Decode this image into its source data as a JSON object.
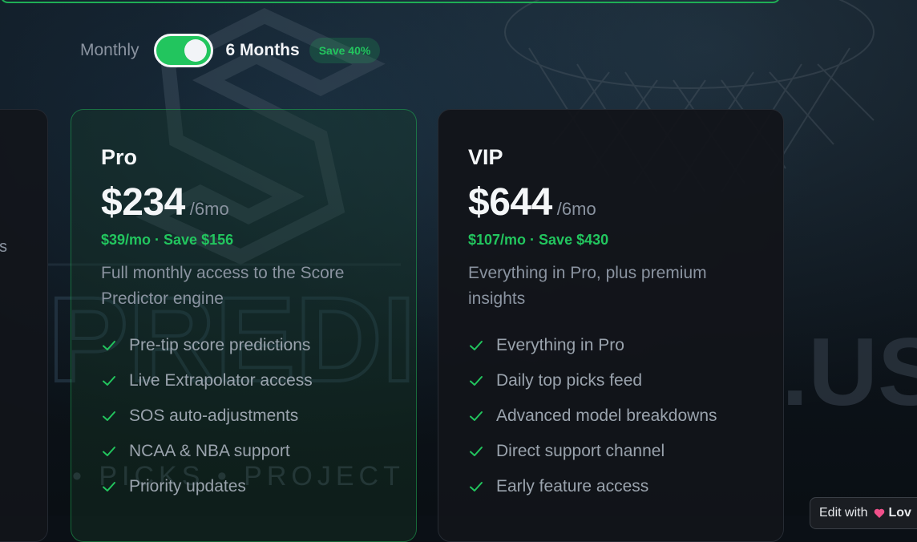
{
  "billing": {
    "monthly_label": "Monthly",
    "six_months_label": "6 Months",
    "save_badge": "Save 40%",
    "toggle_on": true
  },
  "left_card": {
    "text_fragment": "s"
  },
  "plans": [
    {
      "name": "Pro",
      "price": "$234",
      "period": "/6mo",
      "per_month": "$39/mo · Save $156",
      "description": "Full monthly access to the Score Predictor engine",
      "features": [
        "Pre-tip score predictions",
        "Live Extrapolator access",
        "SOS auto-adjustments",
        "NCAA & NBA support",
        "Priority updates"
      ]
    },
    {
      "name": "VIP",
      "price": "$644",
      "period": "/6mo",
      "per_month": "$107/mo · Save $430",
      "description": "Everything in Pro, plus premium insights",
      "features": [
        "Everything in Pro",
        "Daily top picks feed",
        "Advanced model breakdowns",
        "Direct support channel",
        "Early feature access"
      ]
    }
  ],
  "edit_badge": {
    "prefix": "Edit with",
    "brand": "Lov"
  },
  "background_text": {
    "word": "PREDI",
    "suffix": ".US",
    "tagline": "• PICKS • PROJECT"
  },
  "colors": {
    "accent": "#22c55e",
    "background": "#0b1016",
    "muted_text": "#8a93a0"
  },
  "icons": {
    "feature_check": "check-icon",
    "edit_brand": "heart-icon"
  }
}
